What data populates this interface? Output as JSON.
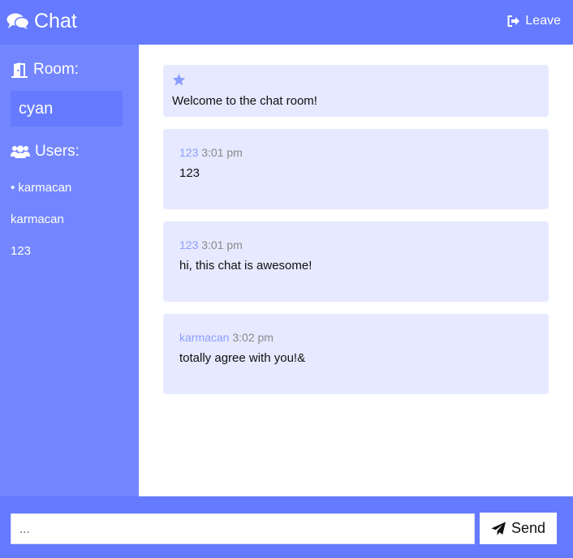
{
  "header": {
    "title": "Chat",
    "leave_label": "Leave"
  },
  "sidebar": {
    "room_heading": "Room:",
    "room_name": "cyan",
    "users_heading": "Users:",
    "users": [
      "• karmacan",
      "karmacan",
      "123"
    ]
  },
  "messages": {
    "welcome": "Welcome to the chat room!",
    "items": [
      {
        "author": "123",
        "time": "3:01 pm",
        "text": "123"
      },
      {
        "author": "123",
        "time": "3:01 pm",
        "text": "hi, this chat is awesome!"
      },
      {
        "author": "karmacan",
        "time": "3:02 pm",
        "text": "totally agree with you!&"
      }
    ]
  },
  "composer": {
    "placeholder": "...",
    "send_label": "Send"
  },
  "colors": {
    "header": "#667aff",
    "sidebar": "#7386ff",
    "message_bg": "#e6e9ff",
    "author": "#8c9dff"
  },
  "icons": {
    "brand": "comments-icon",
    "leave": "sign-out-icon",
    "room": "door-icon",
    "users": "users-icon",
    "welcome": "star-icon",
    "send": "paper-plane-icon"
  }
}
